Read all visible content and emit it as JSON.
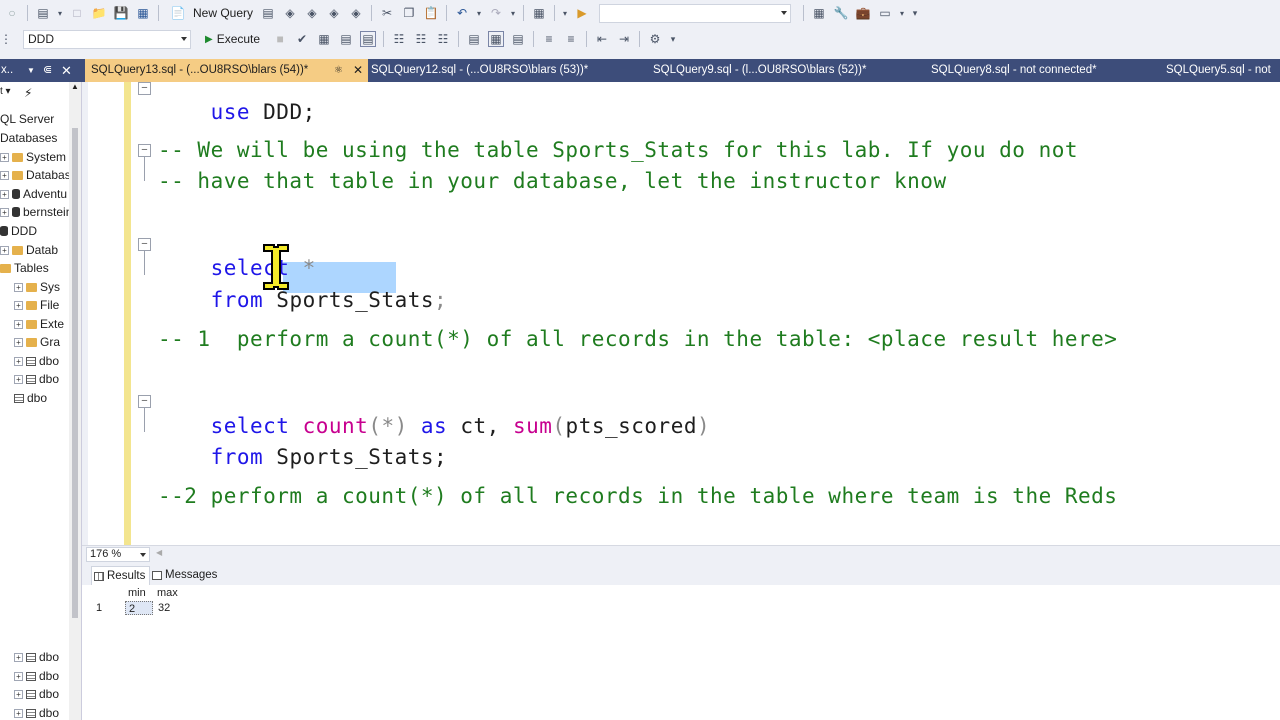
{
  "toolbar1": {
    "new_query_label": "New Query",
    "right_dropdown_value": ""
  },
  "toolbar2": {
    "database_value": "DDD",
    "execute_label": "Execute"
  },
  "explorer": {
    "header_label": "...x...",
    "header_short": "x..",
    "rows": [
      {
        "label": "QL Server",
        "indent": 0
      },
      {
        "label": "Databases",
        "indent": 0
      },
      {
        "label": "System D",
        "indent": 1
      },
      {
        "label": "Database",
        "indent": 1
      },
      {
        "label": "Adventu",
        "indent": 1
      },
      {
        "label": "bernstein",
        "indent": 1
      },
      {
        "label": "DDD",
        "indent": 1
      },
      {
        "label": "Datab",
        "indent": 2
      },
      {
        "label": "Tables",
        "indent": 2
      },
      {
        "label": "Sys",
        "indent": 3
      },
      {
        "label": "File",
        "indent": 3
      },
      {
        "label": "Exte",
        "indent": 3
      },
      {
        "label": "Gra",
        "indent": 3
      },
      {
        "label": "dbo",
        "indent": 3
      },
      {
        "label": "dbo",
        "indent": 3
      },
      {
        "label": "dbo",
        "indent": 3
      },
      {
        "label": "dbo",
        "indent": 3
      },
      {
        "label": "dbo",
        "indent": 3
      },
      {
        "label": "dbo",
        "indent": 3
      },
      {
        "label": "dbo",
        "indent": 3
      }
    ]
  },
  "tabs": [
    {
      "label": "SQLQuery13.sql - (...OU8RSO\\blars (54))*",
      "active": true
    },
    {
      "label": "SQLQuery12.sql - (...OU8RSO\\blars (53))*",
      "active": false
    },
    {
      "label": "SQLQuery9.sql - (l...OU8RSO\\blars (52))*",
      "active": false
    },
    {
      "label": "SQLQuery8.sql - not connected*",
      "active": false
    },
    {
      "label": "SQLQuery5.sql - not",
      "active": false
    }
  ],
  "editor": {
    "l1_kw": "use",
    "l1_rest": " DDD;",
    "l2": "-- We will be using the table Sports_Stats for this lab. If you do not",
    "l3": "-- have that table in your database, let the instructor know",
    "l4_kw": "select",
    "l4_rest": " *",
    "l5_kw": "from",
    "l5_a": " Spor",
    "l5_b": "ts_Stats",
    "l5_c": ";",
    "l6": "-- 1  perform a count(*) of all records in the table: <place result here>",
    "l7_kw1": "select",
    "l7_fn1": "count",
    "l7_p1": "(*)",
    "l7_kw2": "as",
    "l7_t1": "ct,",
    "l7_fn2": "sum",
    "l7_p2": "(",
    "l7_t2": "pts_scored",
    "l7_p3": ")",
    "l8_kw": "from",
    "l8_rest": " Sports_Stats;",
    "l9": "--2 perform a count(*) of all records in the table where team is the Reds"
  },
  "zoom": {
    "value": "176 %"
  },
  "results": {
    "tab_results": "Results",
    "tab_messages": "Messages",
    "columns": [
      "min",
      "max"
    ],
    "row_number": "1",
    "row": [
      "2",
      "32"
    ]
  }
}
